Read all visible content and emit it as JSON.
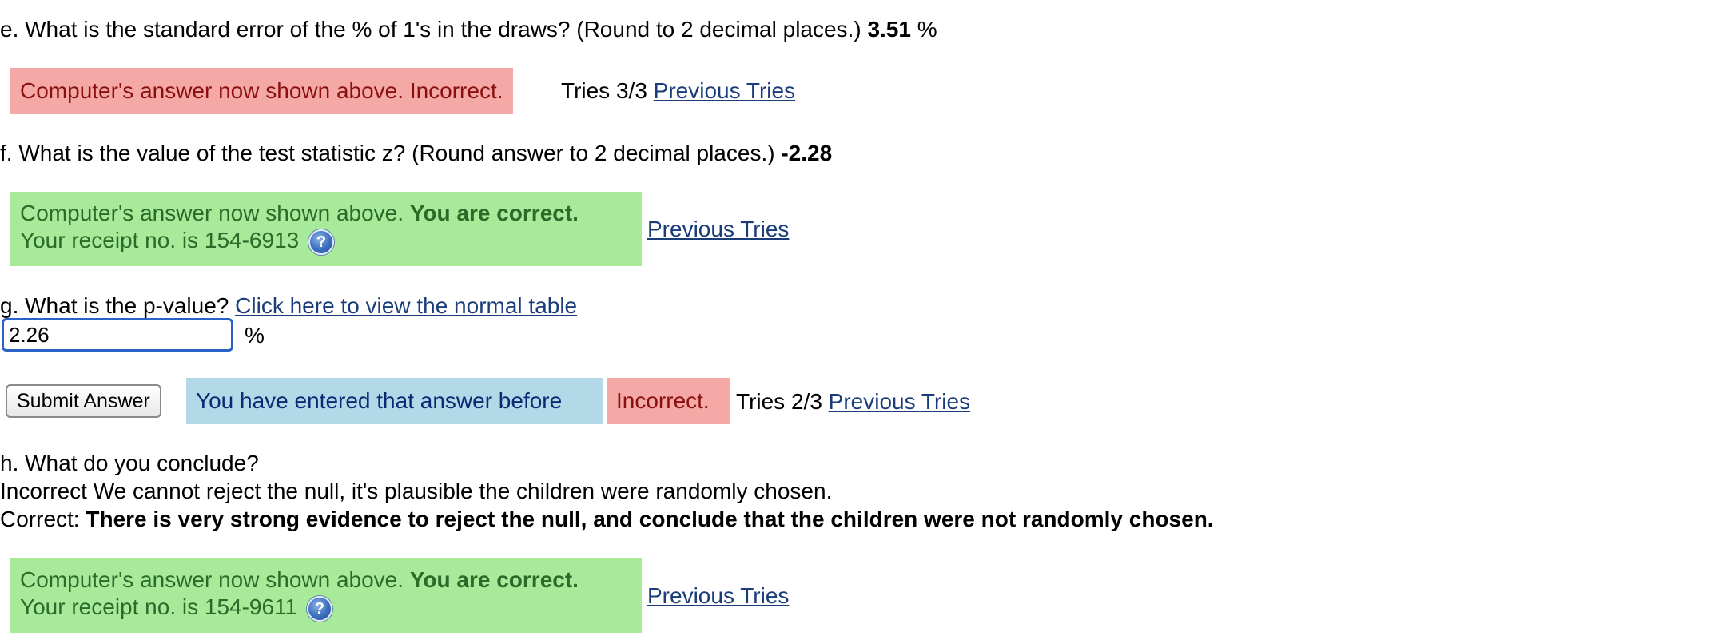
{
  "question_e": {
    "text": "e. What is the standard error of the % of 1's in the draws? (Round to 2 decimal places.)",
    "answer": "3.51",
    "unit": "%",
    "status": "Computer's answer now shown above. Incorrect.",
    "tries": "Tries 3/3",
    "previous_tries_link": "Previous Tries"
  },
  "question_f": {
    "text": "f. What is the value of the test statistic z? (Round answer to 2 decimal places.)",
    "answer": "-2.28",
    "status_prefix": "Computer's answer now shown above.",
    "status_correct": "You are correct.",
    "receipt": "Your receipt no. is 154-6913",
    "help_icon": "?",
    "previous_tries_link": "Previous Tries"
  },
  "question_g": {
    "text": "g. What is the p-value?",
    "table_link": "Click here to view the normal table",
    "input_value": "2.26",
    "unit": "%",
    "submit_label": "Submit Answer",
    "entered_before": "You have entered that answer before",
    "status": "Incorrect.",
    "tries": "Tries 2/3",
    "previous_tries_link": "Previous Tries"
  },
  "question_h": {
    "text": "h. What do you conclude?",
    "incorrect_line": "Incorrect We cannot reject the null, it's plausible the children were randomly chosen.",
    "correct_label": "Correct:",
    "correct_answer": "There is very strong evidence to reject the null, and conclude that the children were not randomly chosen.",
    "status_prefix": "Computer's answer now shown above.",
    "status_correct": "You are correct.",
    "receipt": "Your receipt no. is 154-9611",
    "help_icon": "?",
    "previous_tries_link": "Previous Tries"
  },
  "colors": {
    "incorrect_bg": "#f4a9a6",
    "correct_bg": "#a6ea9a",
    "notice_bg": "#b3d8e8",
    "link": "#1a3d7a"
  },
  "icons": {
    "help": "help-icon"
  }
}
